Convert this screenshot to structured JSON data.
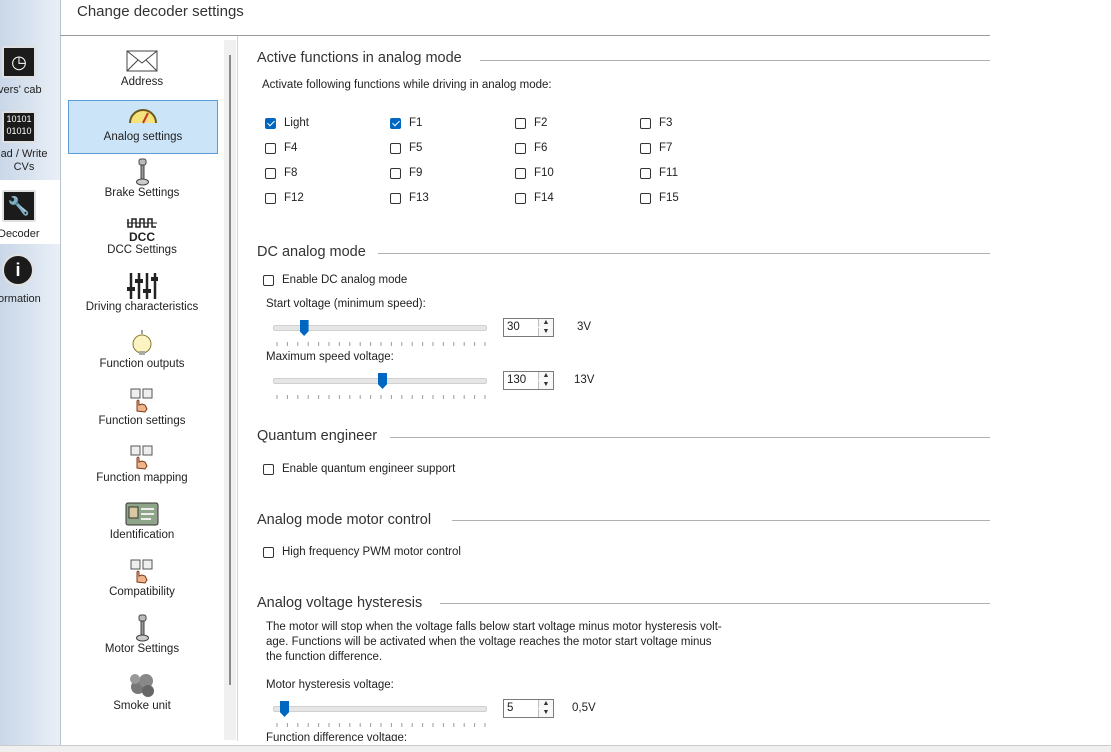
{
  "window": {
    "title": "Change decoder settings"
  },
  "toolbar": {
    "items": [
      {
        "label": "vers' cab",
        "icon": "drivers-cab-icon"
      },
      {
        "label": "ad / Write CVs",
        "icon": "read-write-cvs-icon"
      },
      {
        "label": "Decoder",
        "icon": "wrench-icon",
        "selected": true
      },
      {
        "label": "ormation",
        "icon": "info-icon"
      }
    ]
  },
  "nav": {
    "items": [
      {
        "label": "Address",
        "icon": "envelope-icon"
      },
      {
        "label": "Analog settings",
        "icon": "gauge-icon",
        "selected": true
      },
      {
        "label": "Brake Settings",
        "icon": "brake-lever-icon"
      },
      {
        "label": "DCC Settings",
        "icon": "dcc-icon",
        "icon_text": "DCC"
      },
      {
        "label": "Driving characteristics",
        "icon": "sliders-icon"
      },
      {
        "label": "Function outputs",
        "icon": "bulb-icon"
      },
      {
        "label": "Function settings",
        "icon": "hand-buttons-icon"
      },
      {
        "label": "Function mapping",
        "icon": "hand-buttons-icon"
      },
      {
        "label": "Identification",
        "icon": "id-card-icon"
      },
      {
        "label": "Compatibility",
        "icon": "hand-buttons-icon"
      },
      {
        "label": "Motor Settings",
        "icon": "brake-lever-icon"
      },
      {
        "label": "Smoke unit",
        "icon": "smoke-icon"
      }
    ]
  },
  "analog_functions": {
    "title": "Active functions in analog mode",
    "description": "Activate following functions while driving in analog mode:",
    "functions": [
      {
        "label": "Light",
        "checked": true
      },
      {
        "label": "F1",
        "checked": true
      },
      {
        "label": "F2",
        "checked": false
      },
      {
        "label": "F3",
        "checked": false
      },
      {
        "label": "F4",
        "checked": false
      },
      {
        "label": "F5",
        "checked": false
      },
      {
        "label": "F6",
        "checked": false
      },
      {
        "label": "F7",
        "checked": false
      },
      {
        "label": "F8",
        "checked": false
      },
      {
        "label": "F9",
        "checked": false
      },
      {
        "label": "F10",
        "checked": false
      },
      {
        "label": "F11",
        "checked": false
      },
      {
        "label": "F12",
        "checked": false
      },
      {
        "label": "F13",
        "checked": false
      },
      {
        "label": "F14",
        "checked": false
      },
      {
        "label": "F15",
        "checked": false
      }
    ]
  },
  "dc_mode": {
    "title": "DC analog mode",
    "enable_label": "Enable DC analog mode",
    "enable_checked": false,
    "start_voltage": {
      "label": "Start voltage (minimum speed):",
      "value": "30",
      "unit": "3V",
      "level": 0.118
    },
    "max_voltage": {
      "label": "Maximum speed voltage:",
      "value": "130",
      "unit": "13V",
      "level": 0.51
    }
  },
  "quantum": {
    "title": "Quantum engineer",
    "enable_label": "Enable quantum engineer support",
    "enable_checked": false
  },
  "motor_control": {
    "title": "Analog mode motor control",
    "pwm_label": "High frequency PWM motor control",
    "pwm_checked": false
  },
  "hysteresis": {
    "title": "Analog voltage hysteresis",
    "description_lines": [
      "The motor will stop when the voltage falls below start voltage minus motor hysteresis volt-",
      "age. Functions will be activated when the voltage reaches the motor start voltage minus",
      "the function difference."
    ],
    "motor": {
      "label": "Motor hysteresis voltage:",
      "value": "5",
      "unit": "0,5V",
      "level": 0.02
    },
    "function_label": "Function difference voltage:"
  },
  "colors": {
    "accent": "#0067c0",
    "selection": "#cce4f7",
    "selection_border": "#5a9bd5"
  }
}
